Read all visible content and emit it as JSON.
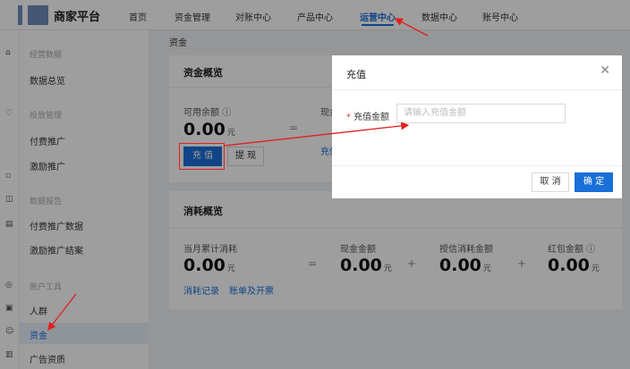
{
  "topbar": {
    "brand": "商家平台",
    "nav": [
      "首页",
      "资金管理",
      "对账中心",
      "产品中心",
      "运营中心",
      "数据中心",
      "账号中心"
    ]
  },
  "sidebar": {
    "groups": [
      {
        "title": "经营数据",
        "items": [
          "数据总览"
        ]
      },
      {
        "title": "投放管理",
        "items": [
          "付费推广",
          "激励推广"
        ]
      },
      {
        "title": "数据报告",
        "items": [
          "付费推广数据",
          "激励推广结案"
        ]
      },
      {
        "title": "账户工具",
        "items": [
          "人群",
          "资金",
          "广告资质"
        ]
      }
    ],
    "active_item": "资金"
  },
  "breadcrumb": "资金",
  "fund_overview": {
    "title": "资金概览",
    "available_label": "可用余额",
    "available_value": "0.00",
    "unit": "元",
    "cash_label": "现金",
    "recharge_link": "充值",
    "recharge_button": "充 值",
    "withdraw_button": "提 现"
  },
  "consumption": {
    "title": "消耗概览",
    "cols": [
      {
        "label": "当月累计消耗",
        "value": "0.00"
      },
      {
        "label": "现金金额",
        "value": "0.00"
      },
      {
        "label": "授信消耗金额",
        "value": "0.00"
      },
      {
        "label": "红包金额",
        "value": "0.00"
      }
    ],
    "unit": "元",
    "links": [
      "消耗记录",
      "账单及开票"
    ]
  },
  "modal": {
    "title": "充值",
    "amount_label": "充值金额",
    "amount_placeholder": "请输入充值金额",
    "cancel": "取 消",
    "confirm": "确 定"
  },
  "colors": {
    "accent": "#1a6fd8",
    "annotation": "#e02020"
  }
}
